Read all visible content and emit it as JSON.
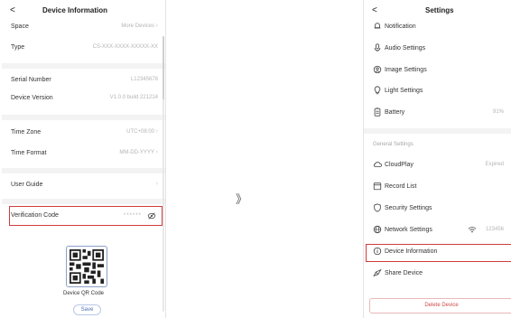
{
  "left": {
    "back_icon": "chevron-left-icon",
    "title": "Device Information",
    "rows": [
      {
        "label": "Space",
        "value": "More Devices"
      },
      {
        "label": "Type",
        "value": "CS-XXX-XXXX-XXXXX-XX"
      },
      {
        "label": "Serial Number",
        "value": "L12345678"
      },
      {
        "label": "Device Version",
        "value": "V1.0.0 build 221214"
      },
      {
        "label": "Time Zone",
        "value": "UTC+08:00"
      },
      {
        "label": "Time Format",
        "value": "MM-DD-YYYY"
      },
      {
        "label": "User Guide",
        "value": ""
      },
      {
        "label": "Verification Code",
        "value": "******"
      }
    ],
    "qr_caption": "Device QR Code",
    "save_label": "Save"
  },
  "arrow": "》",
  "right": {
    "back_icon": "chevron-left-icon",
    "title": "Settings",
    "items_top": [
      {
        "label": "Notification",
        "icon": "bell-icon",
        "value": ""
      },
      {
        "label": "Audio Settings",
        "icon": "microphone-icon",
        "value": ""
      },
      {
        "label": "Image Settings",
        "icon": "camera-icon",
        "value": ""
      },
      {
        "label": "Light Settings",
        "icon": "lightbulb-icon",
        "value": ""
      },
      {
        "label": "Battery",
        "icon": "battery-icon",
        "value": "91%"
      }
    ],
    "section_label": "General Settings",
    "items_general": [
      {
        "label": "CloudPlay",
        "icon": "cloud-icon",
        "value": "Expired"
      },
      {
        "label": "Record List",
        "icon": "calendar-icon",
        "value": ""
      },
      {
        "label": "Security Settings",
        "icon": "shield-icon",
        "value": ""
      },
      {
        "label": "Network Settings",
        "icon": "globe-icon",
        "value": "123456"
      },
      {
        "label": "Device Information",
        "icon": "info-icon",
        "value": ""
      },
      {
        "label": "Share Device",
        "icon": "share-icon",
        "value": ""
      }
    ],
    "delete_label": "Delete Device"
  },
  "colors": {
    "highlight": "#d23b3b",
    "accent": "#4a6fb5"
  }
}
